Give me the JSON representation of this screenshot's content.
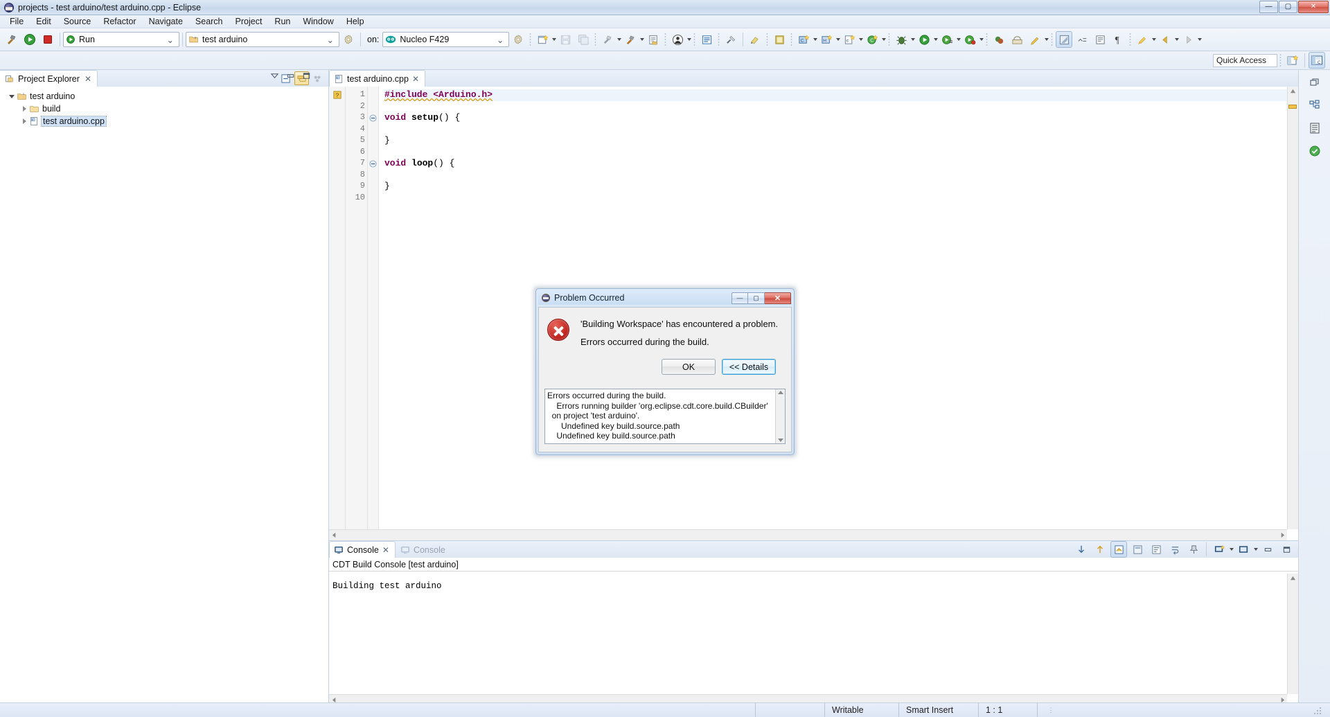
{
  "window": {
    "title": "projects - test arduino/test arduino.cpp - Eclipse",
    "logo_icon": "eclipse-logo-icon",
    "minimize_label": "—",
    "maximize_label": "▢",
    "close_label": "✕"
  },
  "menubar": {
    "items": [
      {
        "label": "File"
      },
      {
        "label": "Edit"
      },
      {
        "label": "Source"
      },
      {
        "label": "Refactor"
      },
      {
        "label": "Navigate"
      },
      {
        "label": "Search"
      },
      {
        "label": "Project"
      },
      {
        "label": "Run"
      },
      {
        "label": "Window"
      },
      {
        "label": "Help"
      }
    ]
  },
  "toolbar": {
    "build_icon": "hammer-icon",
    "run_icon": "run-green-play-icon",
    "stop_icon": "stop-red-square-icon",
    "launch_mode_combo": {
      "value": "Run",
      "icon": "run-green-play-icon",
      "caret": "⌄"
    },
    "project_combo": {
      "value": "test arduino",
      "icon": "c-project-folder-icon",
      "caret": "⌄"
    },
    "project_settings_icon": "gear-icon",
    "on_label": "on:",
    "target_combo": {
      "value": "Nucleo F429",
      "icon": "arduino-board-icon",
      "caret": "⌄"
    },
    "target_settings_icon": "gear-icon",
    "buttons": [
      {
        "name": "new-wizard-icon",
        "glyph": "new"
      },
      {
        "name": "save-icon",
        "glyph": "save"
      },
      {
        "name": "save-all-icon",
        "glyph": "saveall"
      },
      {
        "name": "build-all-icon",
        "glyph": "buildall"
      },
      {
        "name": "build-hammer-icon",
        "glyph": "hammer"
      },
      {
        "name": "build-configurations-icon",
        "glyph": "buildcfg"
      },
      {
        "name": "user-icon",
        "glyph": "user"
      },
      {
        "name": "open-element-icon",
        "glyph": "element"
      },
      {
        "name": "search-icon",
        "glyph": "search"
      },
      {
        "name": "marker-icon",
        "glyph": "marker"
      },
      {
        "name": "toggle-block-icon",
        "glyph": "block"
      },
      {
        "name": "next-annotation-icon",
        "glyph": "annot"
      },
      {
        "name": "debug-perspective-icon",
        "glyph": "persp"
      },
      {
        "name": "new-c-class-icon",
        "glyph": "cclass"
      },
      {
        "name": "new-cpp-class-icon",
        "glyph": "cppclass"
      },
      {
        "name": "new-c-file-icon",
        "glyph": "cfile"
      },
      {
        "name": "new-source-folder-icon",
        "glyph": "srcfolder"
      },
      {
        "name": "debug-bug-icon",
        "glyph": "bug"
      },
      {
        "name": "run-icon",
        "glyph": "run"
      },
      {
        "name": "run-external-tool-icon",
        "glyph": "runext"
      },
      {
        "name": "profile-icon",
        "glyph": "profile"
      },
      {
        "name": "skip-breakpoints-icon",
        "glyph": "skipbp"
      },
      {
        "name": "open-terminal-icon",
        "glyph": "terminal"
      },
      {
        "name": "pencil-icon",
        "glyph": "pencil"
      },
      {
        "name": "toggle-mark-occurrences-icon",
        "glyph": "occur"
      },
      {
        "name": "show-whitespace-icon",
        "glyph": "ws"
      },
      {
        "name": "block-selection-icon",
        "glyph": "blocksel"
      },
      {
        "name": "last-edit-location-icon",
        "glyph": "lastedit"
      },
      {
        "name": "back-icon",
        "glyph": "back"
      },
      {
        "name": "forward-icon",
        "glyph": "fwd"
      }
    ]
  },
  "quick_access": {
    "placeholder": "Quick Access",
    "value": "Quick Access",
    "open_perspective_icon": "open-perspective-icon",
    "cpp_perspective_icon": "cpp-perspective-icon"
  },
  "project_explorer": {
    "tab_label": "Project Explorer",
    "tab_icon": "project-explorer-icon",
    "close_icon": "close-x-icon",
    "collapse_all_icon": "collapse-all-icon",
    "link_with_editor_icon": "link-with-editor-icon",
    "view_menu_icon": "view-menu-icon",
    "tree": [
      {
        "label": "test arduino",
        "icon": "c-project-icon",
        "expanded": true,
        "depth": 0
      },
      {
        "label": "build",
        "icon": "folder-icon",
        "expanded": false,
        "depth": 1
      },
      {
        "label": "test arduino.cpp",
        "icon": "cpp-file-icon",
        "expanded": false,
        "depth": 1,
        "selected": true
      }
    ]
  },
  "editor": {
    "minimize_icon": "minimize-icon",
    "maximize_icon": "maximize-icon",
    "view_menu_icon": "view-menu-icon",
    "tab": {
      "label": "test arduino.cpp",
      "icon": "cpp-file-icon",
      "close_icon": "close-x-icon"
    },
    "lines": [
      {
        "no": "1",
        "marker": "warning",
        "fold": "",
        "text": "#include <Arduino.h>"
      },
      {
        "no": "2",
        "marker": "",
        "fold": "",
        "text": ""
      },
      {
        "no": "3",
        "marker": "",
        "fold": "collapse",
        "text": "void setup() {"
      },
      {
        "no": "4",
        "marker": "",
        "fold": "",
        "text": ""
      },
      {
        "no": "5",
        "marker": "",
        "fold": "",
        "text": "}"
      },
      {
        "no": "6",
        "marker": "",
        "fold": "",
        "text": ""
      },
      {
        "no": "7",
        "marker": "",
        "fold": "collapse",
        "text": "void loop() {"
      },
      {
        "no": "8",
        "marker": "",
        "fold": "",
        "text": ""
      },
      {
        "no": "9",
        "marker": "",
        "fold": "",
        "text": "}"
      },
      {
        "no": "10",
        "marker": "",
        "fold": "",
        "text": ""
      }
    ]
  },
  "console": {
    "tabs": [
      {
        "label": "Console",
        "icon": "console-icon",
        "active": true,
        "close_icon": "close-x-icon"
      },
      {
        "label": "Console",
        "icon": "console-icon",
        "active": false
      }
    ],
    "title": "CDT Build Console [test arduino]",
    "body": "Building test arduino",
    "tools": [
      {
        "name": "scroll-down-icon"
      },
      {
        "name": "scroll-up-icon"
      },
      {
        "name": "scroll-lock-icon"
      },
      {
        "name": "clear-console-icon"
      },
      {
        "name": "word-wrap-icon"
      },
      {
        "name": "pin-console-icon"
      },
      {
        "name": "display-selected-console-icon"
      },
      {
        "name": "open-console-icon"
      },
      {
        "name": "minimize-icon"
      },
      {
        "name": "maximize-icon"
      }
    ]
  },
  "dialog": {
    "title": "Problem Occurred",
    "logo_icon": "eclipse-logo-icon",
    "minimize_label": "—",
    "maximize_label": "▢",
    "close_label": "✕",
    "error_icon": "error-cross-icon",
    "message_line1": "'Building Workspace' has encountered a problem.",
    "message_line2": "Errors occurred during the build.",
    "ok_label": "OK",
    "details_label": "<< Details",
    "details_text": "Errors occurred during the build.\n    Errors running builder 'org.eclipse.cdt.core.build.CBuilder'\n  on project 'test arduino'.\n      Undefined key build.source.path\n    Undefined key build.source.path",
    "scroll_up_icon": "scroll-up-arrow-icon",
    "scroll_down_icon": "scroll-down-arrow-icon"
  },
  "rightbar": {
    "icons": [
      {
        "name": "restore-icon"
      },
      {
        "name": "outline-view-icon"
      },
      {
        "name": "task-list-icon"
      },
      {
        "name": "problems-view-icon"
      }
    ]
  },
  "statusbar": {
    "cells": [
      {
        "label": "Writable",
        "name": "writable-status"
      },
      {
        "label": "Smart Insert",
        "name": "insert-mode-status"
      },
      {
        "label": "1 : 1",
        "name": "cursor-position-status"
      }
    ],
    "progress_icon": "progress-indicator-icon"
  },
  "colors": {
    "accent": "#3c9fd6",
    "error": "#c0271f",
    "keyword": "#7f0055",
    "string": "#2a00ff",
    "selection": "#cfe2f7"
  }
}
